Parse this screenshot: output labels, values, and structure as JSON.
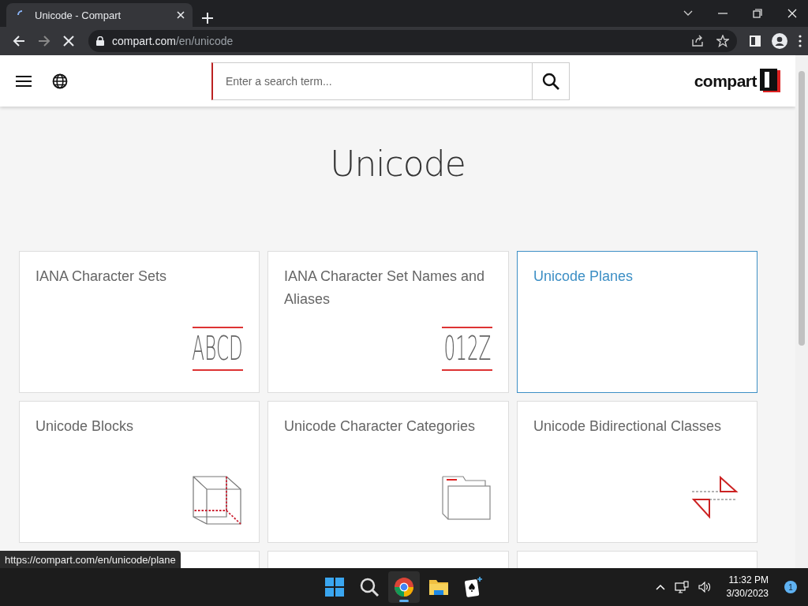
{
  "browser": {
    "tab": {
      "title": "Unicode - Compart",
      "loading": true
    },
    "address": {
      "domain": "compart.com",
      "path": "/en/unicode"
    }
  },
  "header": {
    "search": {
      "placeholder": "Enter a search term..."
    },
    "logo": "compart"
  },
  "page": {
    "title": "Unicode",
    "cards": [
      {
        "title": "IANA Character Sets",
        "kind": "letters",
        "glyphs": "ABCD",
        "selected": false
      },
      {
        "title": "IANA Character Set Names and Aliases",
        "kind": "letters",
        "glyphs": "012Z",
        "selected": false
      },
      {
        "title": "Unicode Planes",
        "kind": "none",
        "selected": true
      },
      {
        "title": "Unicode Blocks",
        "kind": "cube",
        "selected": false
      },
      {
        "title": "Unicode Character Categories",
        "kind": "folder",
        "selected": false
      },
      {
        "title": "Unicode Bidirectional Classes",
        "kind": "bidi",
        "selected": false
      },
      {
        "kind": "none",
        "selected": false
      },
      {
        "kind": "none",
        "selected": false
      },
      {
        "kind": "none",
        "selected": false
      }
    ]
  },
  "status_url": "https://compart.com/en/unicode/plane",
  "taskbar": {
    "apps": [
      {
        "kind": "start",
        "active": false
      },
      {
        "kind": "search",
        "active": false
      },
      {
        "kind": "chrome",
        "active": true
      },
      {
        "kind": "files",
        "active": false
      },
      {
        "kind": "cards",
        "active": false
      }
    ],
    "time": "11:32 PM",
    "date": "3/30/2023",
    "notifications": "1"
  }
}
